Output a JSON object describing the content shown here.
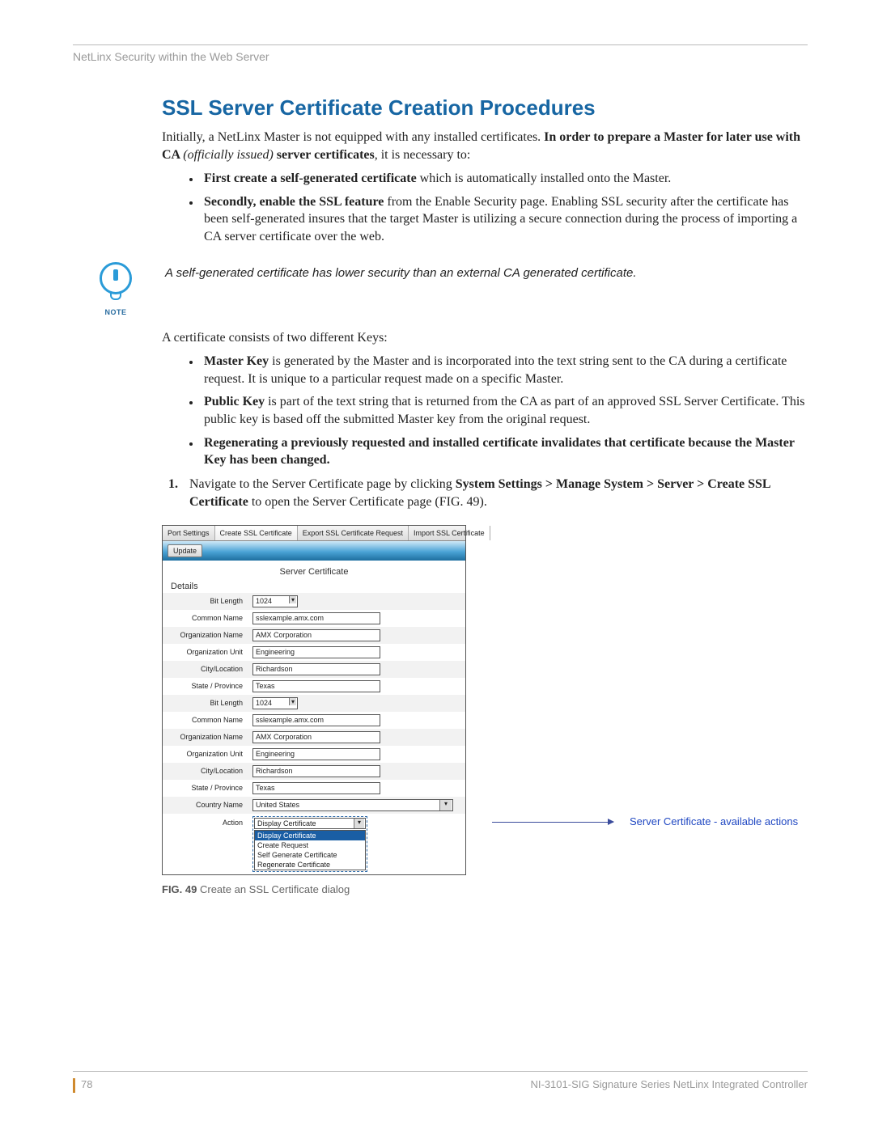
{
  "running_head": "NetLinx Security within the Web Server",
  "title": "SSL Server Certificate Creation Procedures",
  "intro": {
    "p1a": "Initially, a NetLinx Master is not equipped with any installed certificates. ",
    "p1b": "In order to prepare a Master for later use with CA ",
    "p1c": "(officially issued)",
    "p1d": " server certificates",
    "p1e": ", it is necessary to:"
  },
  "bullets_intro": [
    {
      "b": "First create a self-generated certificate",
      "t": " which is automatically installed onto the Master."
    },
    {
      "b": "Secondly, enable the SSL feature",
      "t": " from the Enable Security page. Enabling SSL security after the certificate has been self-generated insures that the target Master is utilizing a secure connection during the process of importing a CA server certificate over the web."
    }
  ],
  "note": {
    "label": "NOTE",
    "text": "A self-generated certificate has lower security than an external CA generated certificate."
  },
  "keys_intro": "A certificate consists of two different Keys:",
  "bullets_keys": [
    {
      "b": "Master Key",
      "t": " is generated by the Master and is incorporated into the text string sent to the CA during a certificate request. It is unique to a particular request made on a specific Master."
    },
    {
      "b": "Public Key",
      "t": " is part of the text string that is returned from the CA as part of an approved SSL Server Certificate. This public key is based off the submitted Master key from the original request."
    },
    {
      "b": "Regenerating a previously requested and installed certificate invalidates that certificate because the Master Key has been changed.",
      "t": ""
    }
  ],
  "step1": {
    "a": "Navigate to the Server Certificate page by clicking ",
    "b": "System Settings > Manage System > Server > Create SSL Certificate",
    "c": " to open the Server Certificate page (FIG. 49)."
  },
  "dialog": {
    "tabs": [
      "Port Settings",
      "Create SSL Certificate",
      "Export SSL Certificate Request",
      "Import SSL Certificate"
    ],
    "update_btn": "Update",
    "title": "Server Certificate",
    "details": "Details",
    "rows": [
      {
        "label": "Bit Length",
        "value": "1024",
        "type": "select"
      },
      {
        "label": "Common Name",
        "value": "sslexample.amx.com",
        "type": "text"
      },
      {
        "label": "Organization Name",
        "value": "AMX Corporation",
        "type": "text"
      },
      {
        "label": "Organization Unit",
        "value": "Engineering",
        "type": "text"
      },
      {
        "label": "City/Location",
        "value": "Richardson",
        "type": "text"
      },
      {
        "label": "State / Province",
        "value": "Texas",
        "type": "text"
      },
      {
        "label": "Bit Length",
        "value": "1024",
        "type": "select"
      },
      {
        "label": "Common Name",
        "value": "sslexample.amx.com",
        "type": "text"
      },
      {
        "label": "Organization Name",
        "value": "AMX Corporation",
        "type": "text"
      },
      {
        "label": "Organization Unit",
        "value": "Engineering",
        "type": "text"
      },
      {
        "label": "City/Location",
        "value": "Richardson",
        "type": "text"
      },
      {
        "label": "State / Province",
        "value": "Texas",
        "type": "text"
      },
      {
        "label": "Country Name",
        "value": "United States",
        "type": "wideselect"
      }
    ],
    "action_label": "Action",
    "action_selected": "Display Certificate",
    "action_options": [
      "Display Certificate",
      "Create Request",
      "Self Generate Certificate",
      "Regenerate Certificate"
    ]
  },
  "callout_text": "Server Certificate - available actions",
  "fig_caption": {
    "num": "FIG. 49",
    "text": "  Create an SSL Certificate dialog"
  },
  "footer": {
    "page": "78",
    "doc": "NI-3101-SIG Signature Series NetLinx Integrated Controller"
  }
}
